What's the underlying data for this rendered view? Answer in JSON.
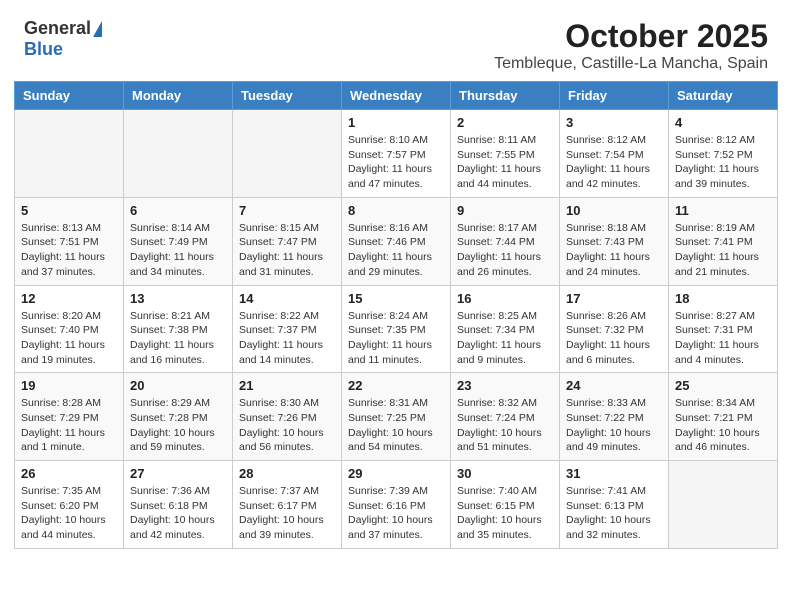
{
  "header": {
    "logo_general": "General",
    "logo_blue": "Blue",
    "month_title": "October 2025",
    "location": "Tembleque, Castille-La Mancha, Spain"
  },
  "weekdays": [
    "Sunday",
    "Monday",
    "Tuesday",
    "Wednesday",
    "Thursday",
    "Friday",
    "Saturday"
  ],
  "weeks": [
    [
      {
        "day": "",
        "info": ""
      },
      {
        "day": "",
        "info": ""
      },
      {
        "day": "",
        "info": ""
      },
      {
        "day": "1",
        "info": "Sunrise: 8:10 AM\nSunset: 7:57 PM\nDaylight: 11 hours and 47 minutes."
      },
      {
        "day": "2",
        "info": "Sunrise: 8:11 AM\nSunset: 7:55 PM\nDaylight: 11 hours and 44 minutes."
      },
      {
        "day": "3",
        "info": "Sunrise: 8:12 AM\nSunset: 7:54 PM\nDaylight: 11 hours and 42 minutes."
      },
      {
        "day": "4",
        "info": "Sunrise: 8:12 AM\nSunset: 7:52 PM\nDaylight: 11 hours and 39 minutes."
      }
    ],
    [
      {
        "day": "5",
        "info": "Sunrise: 8:13 AM\nSunset: 7:51 PM\nDaylight: 11 hours and 37 minutes."
      },
      {
        "day": "6",
        "info": "Sunrise: 8:14 AM\nSunset: 7:49 PM\nDaylight: 11 hours and 34 minutes."
      },
      {
        "day": "7",
        "info": "Sunrise: 8:15 AM\nSunset: 7:47 PM\nDaylight: 11 hours and 31 minutes."
      },
      {
        "day": "8",
        "info": "Sunrise: 8:16 AM\nSunset: 7:46 PM\nDaylight: 11 hours and 29 minutes."
      },
      {
        "day": "9",
        "info": "Sunrise: 8:17 AM\nSunset: 7:44 PM\nDaylight: 11 hours and 26 minutes."
      },
      {
        "day": "10",
        "info": "Sunrise: 8:18 AM\nSunset: 7:43 PM\nDaylight: 11 hours and 24 minutes."
      },
      {
        "day": "11",
        "info": "Sunrise: 8:19 AM\nSunset: 7:41 PM\nDaylight: 11 hours and 21 minutes."
      }
    ],
    [
      {
        "day": "12",
        "info": "Sunrise: 8:20 AM\nSunset: 7:40 PM\nDaylight: 11 hours and 19 minutes."
      },
      {
        "day": "13",
        "info": "Sunrise: 8:21 AM\nSunset: 7:38 PM\nDaylight: 11 hours and 16 minutes."
      },
      {
        "day": "14",
        "info": "Sunrise: 8:22 AM\nSunset: 7:37 PM\nDaylight: 11 hours and 14 minutes."
      },
      {
        "day": "15",
        "info": "Sunrise: 8:24 AM\nSunset: 7:35 PM\nDaylight: 11 hours and 11 minutes."
      },
      {
        "day": "16",
        "info": "Sunrise: 8:25 AM\nSunset: 7:34 PM\nDaylight: 11 hours and 9 minutes."
      },
      {
        "day": "17",
        "info": "Sunrise: 8:26 AM\nSunset: 7:32 PM\nDaylight: 11 hours and 6 minutes."
      },
      {
        "day": "18",
        "info": "Sunrise: 8:27 AM\nSunset: 7:31 PM\nDaylight: 11 hours and 4 minutes."
      }
    ],
    [
      {
        "day": "19",
        "info": "Sunrise: 8:28 AM\nSunset: 7:29 PM\nDaylight: 11 hours and 1 minute."
      },
      {
        "day": "20",
        "info": "Sunrise: 8:29 AM\nSunset: 7:28 PM\nDaylight: 10 hours and 59 minutes."
      },
      {
        "day": "21",
        "info": "Sunrise: 8:30 AM\nSunset: 7:26 PM\nDaylight: 10 hours and 56 minutes."
      },
      {
        "day": "22",
        "info": "Sunrise: 8:31 AM\nSunset: 7:25 PM\nDaylight: 10 hours and 54 minutes."
      },
      {
        "day": "23",
        "info": "Sunrise: 8:32 AM\nSunset: 7:24 PM\nDaylight: 10 hours and 51 minutes."
      },
      {
        "day": "24",
        "info": "Sunrise: 8:33 AM\nSunset: 7:22 PM\nDaylight: 10 hours and 49 minutes."
      },
      {
        "day": "25",
        "info": "Sunrise: 8:34 AM\nSunset: 7:21 PM\nDaylight: 10 hours and 46 minutes."
      }
    ],
    [
      {
        "day": "26",
        "info": "Sunrise: 7:35 AM\nSunset: 6:20 PM\nDaylight: 10 hours and 44 minutes."
      },
      {
        "day": "27",
        "info": "Sunrise: 7:36 AM\nSunset: 6:18 PM\nDaylight: 10 hours and 42 minutes."
      },
      {
        "day": "28",
        "info": "Sunrise: 7:37 AM\nSunset: 6:17 PM\nDaylight: 10 hours and 39 minutes."
      },
      {
        "day": "29",
        "info": "Sunrise: 7:39 AM\nSunset: 6:16 PM\nDaylight: 10 hours and 37 minutes."
      },
      {
        "day": "30",
        "info": "Sunrise: 7:40 AM\nSunset: 6:15 PM\nDaylight: 10 hours and 35 minutes."
      },
      {
        "day": "31",
        "info": "Sunrise: 7:41 AM\nSunset: 6:13 PM\nDaylight: 10 hours and 32 minutes."
      },
      {
        "day": "",
        "info": ""
      }
    ]
  ]
}
